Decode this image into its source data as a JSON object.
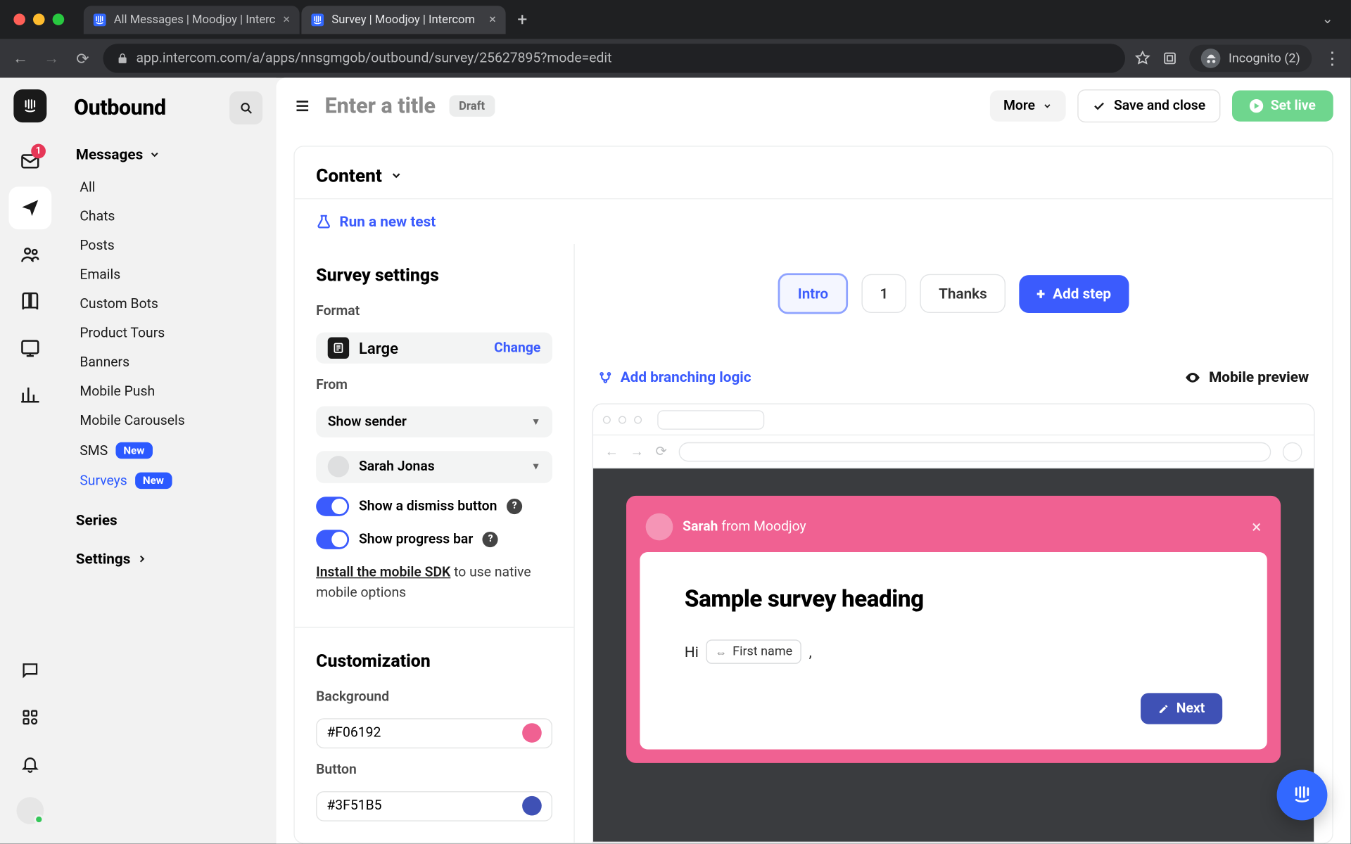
{
  "browser": {
    "tabs": [
      {
        "title": "All Messages | Moodjoy | Interc"
      },
      {
        "title": "Survey | Moodjoy | Intercom"
      }
    ],
    "url": "app.intercom.com/a/apps/nnsgmgob/outbound/survey/25627895?mode=edit",
    "incognito_label": "Incognito (2)"
  },
  "rail": {
    "inbox_badge": "1"
  },
  "sidebar": {
    "title": "Outbound",
    "messages": {
      "label": "Messages",
      "items": [
        "All",
        "Chats",
        "Posts",
        "Emails",
        "Custom Bots",
        "Product Tours",
        "Banners",
        "Mobile Push",
        "Mobile Carousels"
      ],
      "sms_label": "SMS",
      "sms_badge": "New",
      "surveys_label": "Surveys",
      "surveys_badge": "New"
    },
    "series": "Series",
    "settings": "Settings"
  },
  "topbar": {
    "title_placeholder": "Enter a title",
    "draft": "Draft",
    "more": "More",
    "save": "Save and close",
    "set_live": "Set live"
  },
  "content": {
    "header": "Content",
    "run_test": "Run a new test",
    "settings": {
      "title": "Survey settings",
      "format_label": "Format",
      "format_value": "Large",
      "change": "Change",
      "from_label": "From",
      "from_select": "Show sender",
      "from_person": "Sarah Jonas",
      "toggle_dismiss": "Show a dismiss button",
      "toggle_progress": "Show progress bar",
      "sdk_link": "Install the mobile SDK",
      "sdk_suffix": " to use native mobile options",
      "customization": "Customization",
      "bg_label": "Background",
      "bg_value": "#F06192",
      "btn_label": "Button",
      "btn_value": "#3F51B5"
    },
    "steps": {
      "intro": "Intro",
      "one": "1",
      "thanks": "Thanks",
      "add": "Add step"
    },
    "canvas": {
      "branching": "Add branching logic",
      "mobile_preview": "Mobile preview"
    },
    "survey": {
      "sender_name": "Sarah",
      "sender_suffix": " from Moodjoy",
      "heading": "Sample survey heading",
      "hi": "Hi",
      "var": "First name",
      "comma": ",",
      "next": "Next"
    }
  }
}
